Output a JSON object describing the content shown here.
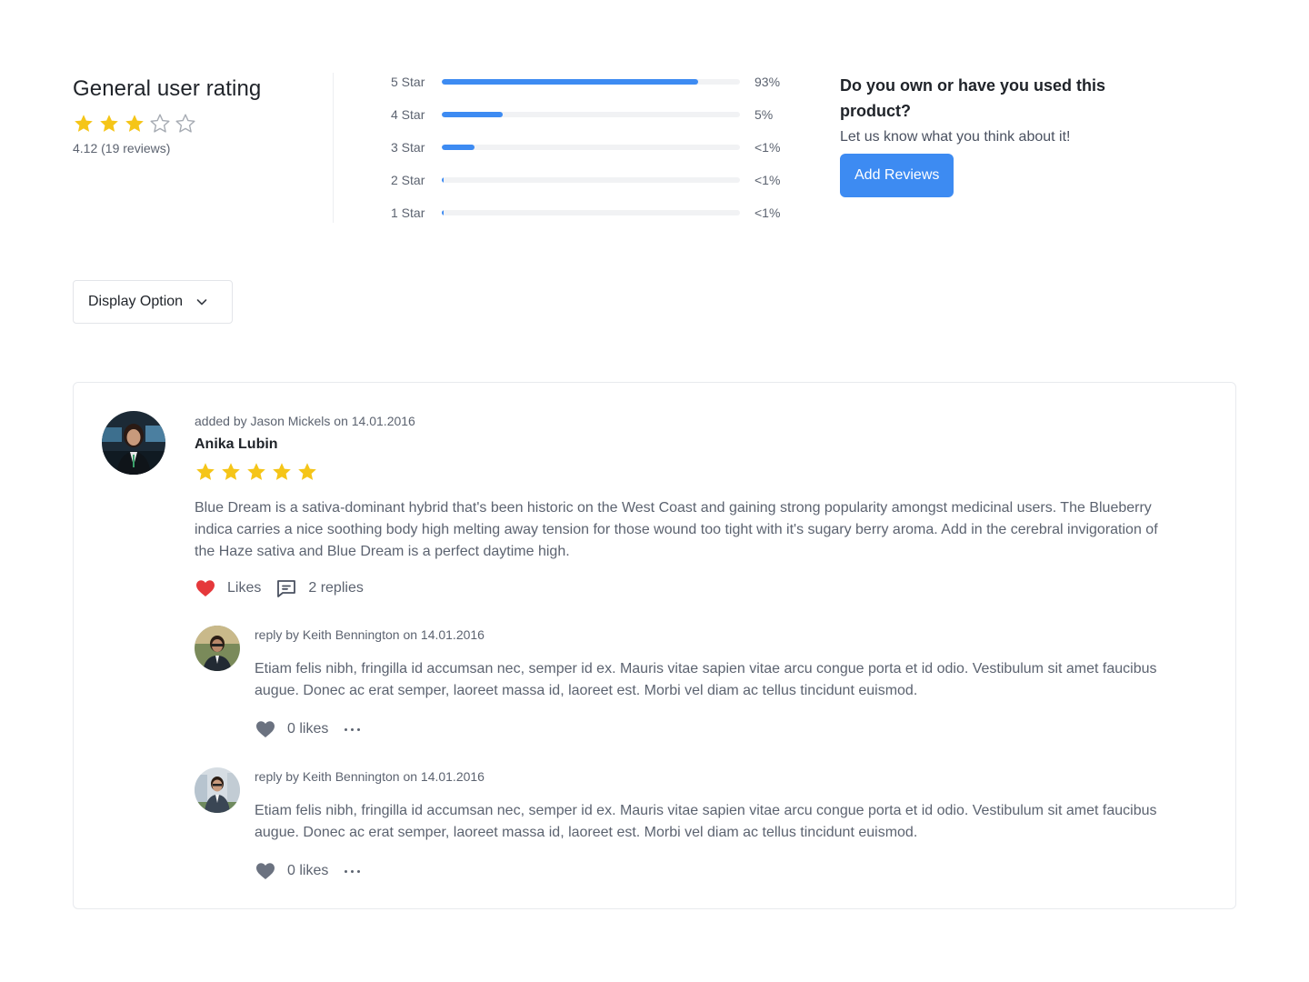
{
  "summary": {
    "title": "General user rating",
    "stars_filled": 3,
    "stars_total": 5,
    "meta": "4.12 (19 reviews)"
  },
  "breakdown": [
    {
      "label": "5 Star",
      "fraction": 0.86,
      "pct": "93%"
    },
    {
      "label": "4 Star",
      "fraction": 0.205,
      "pct": "5%"
    },
    {
      "label": "3 Star",
      "fraction": 0.11,
      "pct": "<1%"
    },
    {
      "label": "2 Star",
      "fraction": 0.006,
      "pct": "<1%"
    },
    {
      "label": "1 Star",
      "fraction": 0.006,
      "pct": "<1%"
    }
  ],
  "cta": {
    "question": "Do you own or have you used this product?",
    "subtitle": "Let us know what you think about it!",
    "button": "Add Reviews"
  },
  "display_option": {
    "label": "Display Option",
    "icon": "chevron-down-icon"
  },
  "review": {
    "added_by": "added by Jason Mickels on 14.01.2016",
    "reviewer": "Anika Lubin",
    "stars_filled": 5,
    "text": "Blue Dream is a sativa-dominant hybrid that's been historic on the West Coast and gaining strong popularity amongst medicinal users. The Blueberry indica carries a nice soothing body high melting away tension for those wound too tight with it's sugary berry aroma. Add in the cerebral invigoration of the Haze sativa and Blue Dream is a perfect daytime high.",
    "likes_label": "Likes",
    "replies_label": "2 replies"
  },
  "replies": [
    {
      "meta": "reply by Keith Bennington on 14.01.2016",
      "text": "Etiam felis nibh, fringilla id accumsan nec, semper id ex. Mauris vitae sapien vitae arcu congue porta et id odio. Vestibulum sit amet faucibus augue. Donec ac erat semper, laoreet massa id, laoreet est. Morbi vel diam ac tellus tincidunt euismod.",
      "likes": "0 likes"
    },
    {
      "meta": "reply by Keith Bennington on 14.01.2016",
      "text": "Etiam felis nibh, fringilla id accumsan nec, semper id ex. Mauris vitae sapien vitae arcu congue porta et id odio. Vestibulum sit amet faucibus augue. Donec ac erat semper, laoreet massa id, laoreet est. Morbi vel diam ac tellus tincidunt euismod.",
      "likes": "0 likes"
    }
  ],
  "colors": {
    "accent": "#3d8bf2",
    "star": "#f5c518",
    "heart_active": "#e5383b",
    "heart_inactive": "#6b7280"
  }
}
